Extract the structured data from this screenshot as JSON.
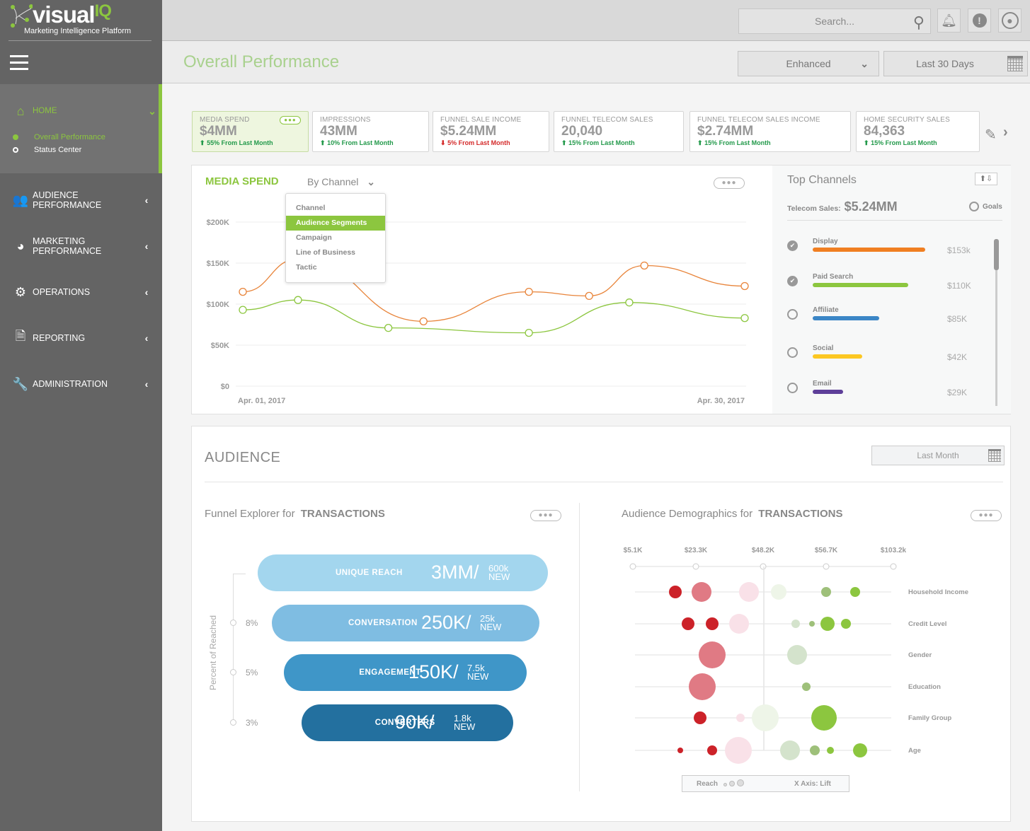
{
  "app": {
    "logo_main": "visual",
    "logo_accent": "IQ",
    "logo_tagline": "Marketing Intelligence Platform"
  },
  "topbar": {
    "search_placeholder": "Search...",
    "icons": [
      "search-icon",
      "bell-icon",
      "alert-icon",
      "user-icon"
    ]
  },
  "sidebar": {
    "items": [
      {
        "label": "HOME",
        "icon": "home-icon",
        "expanded": true,
        "children": [
          {
            "label": "Overall Performance",
            "active": true
          },
          {
            "label": "Status Center",
            "active": false
          }
        ]
      },
      {
        "label": "AUDIENCE PERFORMANCE",
        "icon": "users-icon"
      },
      {
        "label": "MARKETING PERFORMANCE",
        "icon": "dashboard-icon"
      },
      {
        "label": "OPERATIONS",
        "icon": "gears-icon"
      },
      {
        "label": "REPORTING",
        "icon": "document-icon"
      },
      {
        "label": "ADMINISTRATION",
        "icon": "wrench-icon"
      }
    ]
  },
  "header": {
    "title": "Overall Performance",
    "view_select": "Enhanced",
    "date_range": "Last 30 Days"
  },
  "kpis": [
    {
      "title": "MEDIA SPEND",
      "value": "$4MM",
      "delta": "55% From Last Month",
      "direction": "up",
      "active": true
    },
    {
      "title": "IMPRESSIONS",
      "value": "43MM",
      "delta": "10% From Last Month",
      "direction": "up"
    },
    {
      "title": "FUNNEL SALE INCOME",
      "value": "$5.24MM",
      "delta": "5% From Last Month",
      "direction": "down"
    },
    {
      "title": "FUNNEL TELECOM SALES",
      "value": "20,040",
      "delta": "15% From Last Month",
      "direction": "up"
    },
    {
      "title": "FUNNEL TELECOM SALES INCOME",
      "value": "$2.74MM",
      "delta": "15% From Last Month",
      "direction": "up"
    },
    {
      "title": "HOME SECURITY SALES",
      "value": "84,363",
      "delta": "15% From Last Month",
      "direction": "up"
    }
  ],
  "media_spend": {
    "title": "MEDIA SPEND",
    "group_by": "By Channel",
    "menu": [
      "Channel",
      "Audience Segments",
      "Campaign",
      "Line of Business",
      "Tactic"
    ],
    "menu_selected": "Audience Segments",
    "more": "●●●"
  },
  "chart_data": {
    "type": "line",
    "title": "MEDIA SPEND",
    "xlabel": "",
    "ylabel": "",
    "x_labels": [
      "Apr. 01, 2017",
      "Apr. 30, 2017"
    ],
    "y_ticks": [
      "$0",
      "$50K",
      "$100K",
      "$150K",
      "$200K"
    ],
    "ylim": [
      0,
      200000
    ],
    "grid": true,
    "series": [
      {
        "name": "series-orange",
        "color": "#e8843a",
        "x": [
          0,
          0.11,
          0.36,
          0.57,
          0.69,
          0.8,
          1.0
        ],
        "values": [
          115000,
          155000,
          79000,
          115000,
          110000,
          147000,
          122000
        ]
      },
      {
        "name": "series-green",
        "color": "#8cc63f",
        "x": [
          0,
          0.11,
          0.29,
          0.57,
          0.77,
          1.0
        ],
        "values": [
          93000,
          105000,
          71000,
          65000,
          102000,
          83000
        ]
      }
    ]
  },
  "top_channels": {
    "title": "Top Channels",
    "subtitle_label": "Telecom Sales:",
    "subtitle_value": "$5.24MM",
    "goals_label": "Goals",
    "rows": [
      {
        "label": "Display",
        "value": "$153k",
        "fraction": 1.0,
        "color": "#f07f22",
        "checked": true
      },
      {
        "label": "Paid Search",
        "value": "$110K",
        "fraction": 0.85,
        "color": "#8cc63f",
        "checked": true
      },
      {
        "label": "Affiliate",
        "value": "$85K",
        "fraction": 0.59,
        "color": "#3b86c6",
        "checked": false
      },
      {
        "label": "Social",
        "value": "$42K",
        "fraction": 0.44,
        "color": "#fcc722",
        "checked": false
      },
      {
        "label": "Email",
        "value": "$29K",
        "fraction": 0.27,
        "color": "#5e3f99",
        "checked": false
      }
    ]
  },
  "audience": {
    "title": "AUDIENCE",
    "date_range": "Last Month",
    "funnel": {
      "title_prefix": "Funnel Explorer for",
      "title_strong": "TRANSACTIONS",
      "axis_label": "Percent of Reached",
      "stages": [
        {
          "label": "UNIQUE REACH",
          "value": "3MM/",
          "new_value": "600k",
          "new_label": "NEW",
          "pct": "",
          "color": "#a3d6ee"
        },
        {
          "label": "CONVERSATION",
          "value": "250K/",
          "new_value": "25k",
          "new_label": "NEW",
          "pct": "8%",
          "color": "#7fbde2"
        },
        {
          "label": "ENGAGEMENT",
          "value": "150K/",
          "new_value": "7.5k",
          "new_label": "NEW",
          "pct": "5%",
          "color": "#3f96c8"
        },
        {
          "label": "CONVERTERS",
          "value": "90K/",
          "new_value": "1.8k",
          "new_label": "NEW",
          "pct": "3%",
          "color": "#23709f"
        }
      ]
    },
    "demographics": {
      "title_prefix": "Audience Demographics for",
      "title_strong": "TRANSACTIONS",
      "x_ticks": [
        "$5.1K",
        "$23.3K",
        "$48.2K",
        "$56.7K",
        "$103.2k"
      ],
      "rows": [
        "Household Income",
        "Credit Level",
        "Gender",
        "Education",
        "Family Group",
        "Age"
      ],
      "legend_reach": "Reach",
      "legend_axis": "X Axis: Lift"
    }
  }
}
